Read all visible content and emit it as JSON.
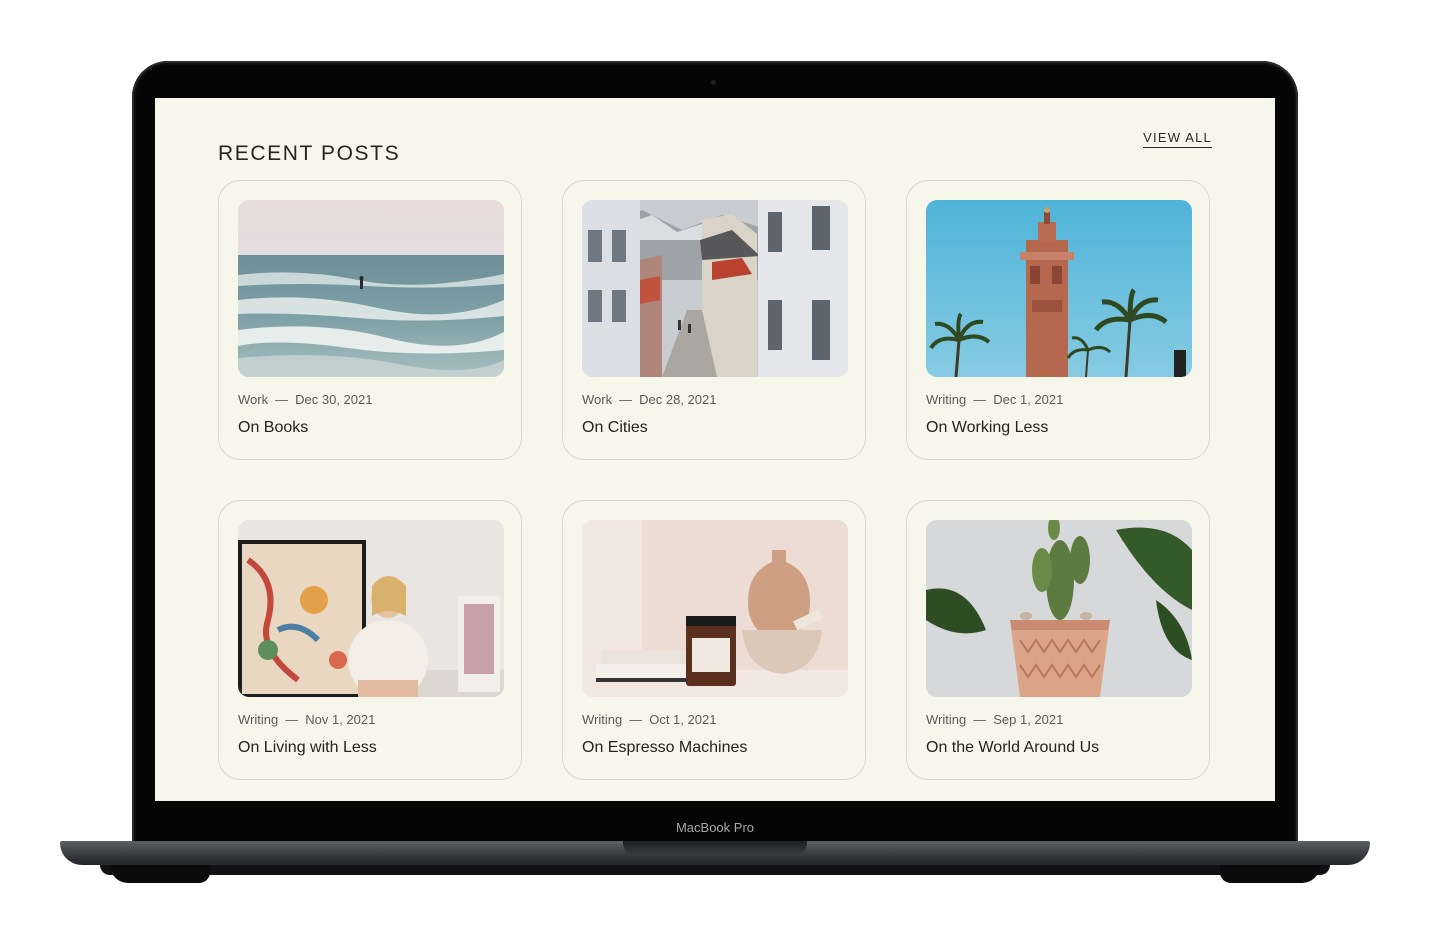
{
  "device": {
    "label": "MacBook Pro"
  },
  "header": {
    "title": "RECENT POSTS",
    "view_all_label": "VIEW ALL"
  },
  "posts": [
    {
      "category": "Work",
      "date": "Dec 30, 2021",
      "title": "On Books",
      "image": "ocean-surfer-image"
    },
    {
      "category": "Work",
      "date": "Dec 28, 2021",
      "title": "On Cities",
      "image": "city-street-image"
    },
    {
      "category": "Writing",
      "date": "Dec 1, 2021",
      "title": "On Working Less",
      "image": "minaret-tower-image"
    },
    {
      "category": "Writing",
      "date": "Nov 1, 2021",
      "title": "On Living with Less",
      "image": "woman-with-painting-image"
    },
    {
      "category": "Writing",
      "date": "Oct 1, 2021",
      "title": "On Espresso Machines",
      "image": "candle-and-vase-image"
    },
    {
      "category": "Writing",
      "date": "Sep 1, 2021",
      "title": "On the World Around Us",
      "image": "cactus-pot-image"
    }
  ],
  "separator": "—",
  "colors": {
    "screen_background": "#f6f6ea",
    "card_border": "#d8d8c8",
    "text_primary": "#23231f",
    "text_meta": "#5c5c55"
  }
}
